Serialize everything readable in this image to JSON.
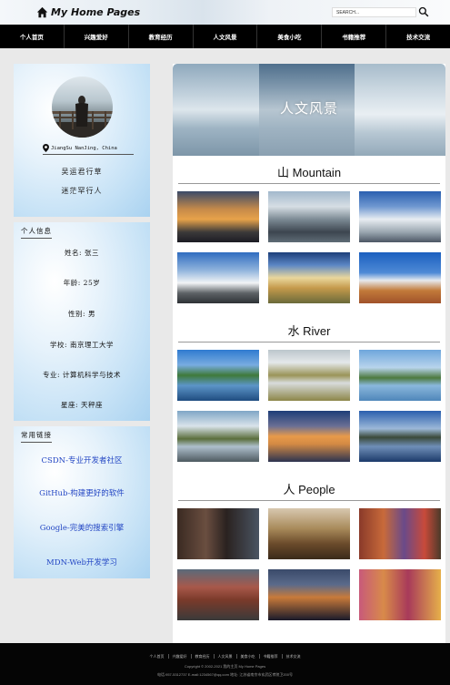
{
  "header": {
    "site_name": "My Home Pages",
    "search_placeholder": "SEARCH..."
  },
  "nav": [
    "个人首页",
    "兴趣爱好",
    "教育经历",
    "人文风景",
    "美食小吃",
    "书籍推荐",
    "技术交流"
  ],
  "profile": {
    "location": "JiangSu NanJing, China",
    "motto": [
      "吴运君行草",
      "迷茫罕行人"
    ]
  },
  "info": {
    "title": "个人信息",
    "rows": [
      "姓名: 张三",
      "年龄: 25岁",
      "性别: 男",
      "学校: 南京理工大学",
      "专业: 计算机科学与技术",
      "星座: 天秤座"
    ]
  },
  "links": {
    "title": "常用链接",
    "items": [
      "CSDN-专业开发者社区",
      "GitHub-构建更好的软件",
      "Google-完美的搜索引擎",
      "MDN-Web开发学习"
    ]
  },
  "main": {
    "banner_title": "人文风景",
    "sections": [
      {
        "title": "山 Mountain"
      },
      {
        "title": "水 River"
      },
      {
        "title": "人 People"
      }
    ]
  },
  "footer": {
    "links": [
      "个人首页",
      "兴趣爱好",
      "教育经历",
      "人文风景",
      "美食小吃",
      "书籍推荐",
      "技术交流"
    ],
    "copyright": "Copyright © 2002-2021 我的主页 My Home Pages",
    "contact": "电话:957-5312737 E-mail:1234567@qq.com 地址: 江苏省南京市玄武区孝陵卫200号"
  }
}
